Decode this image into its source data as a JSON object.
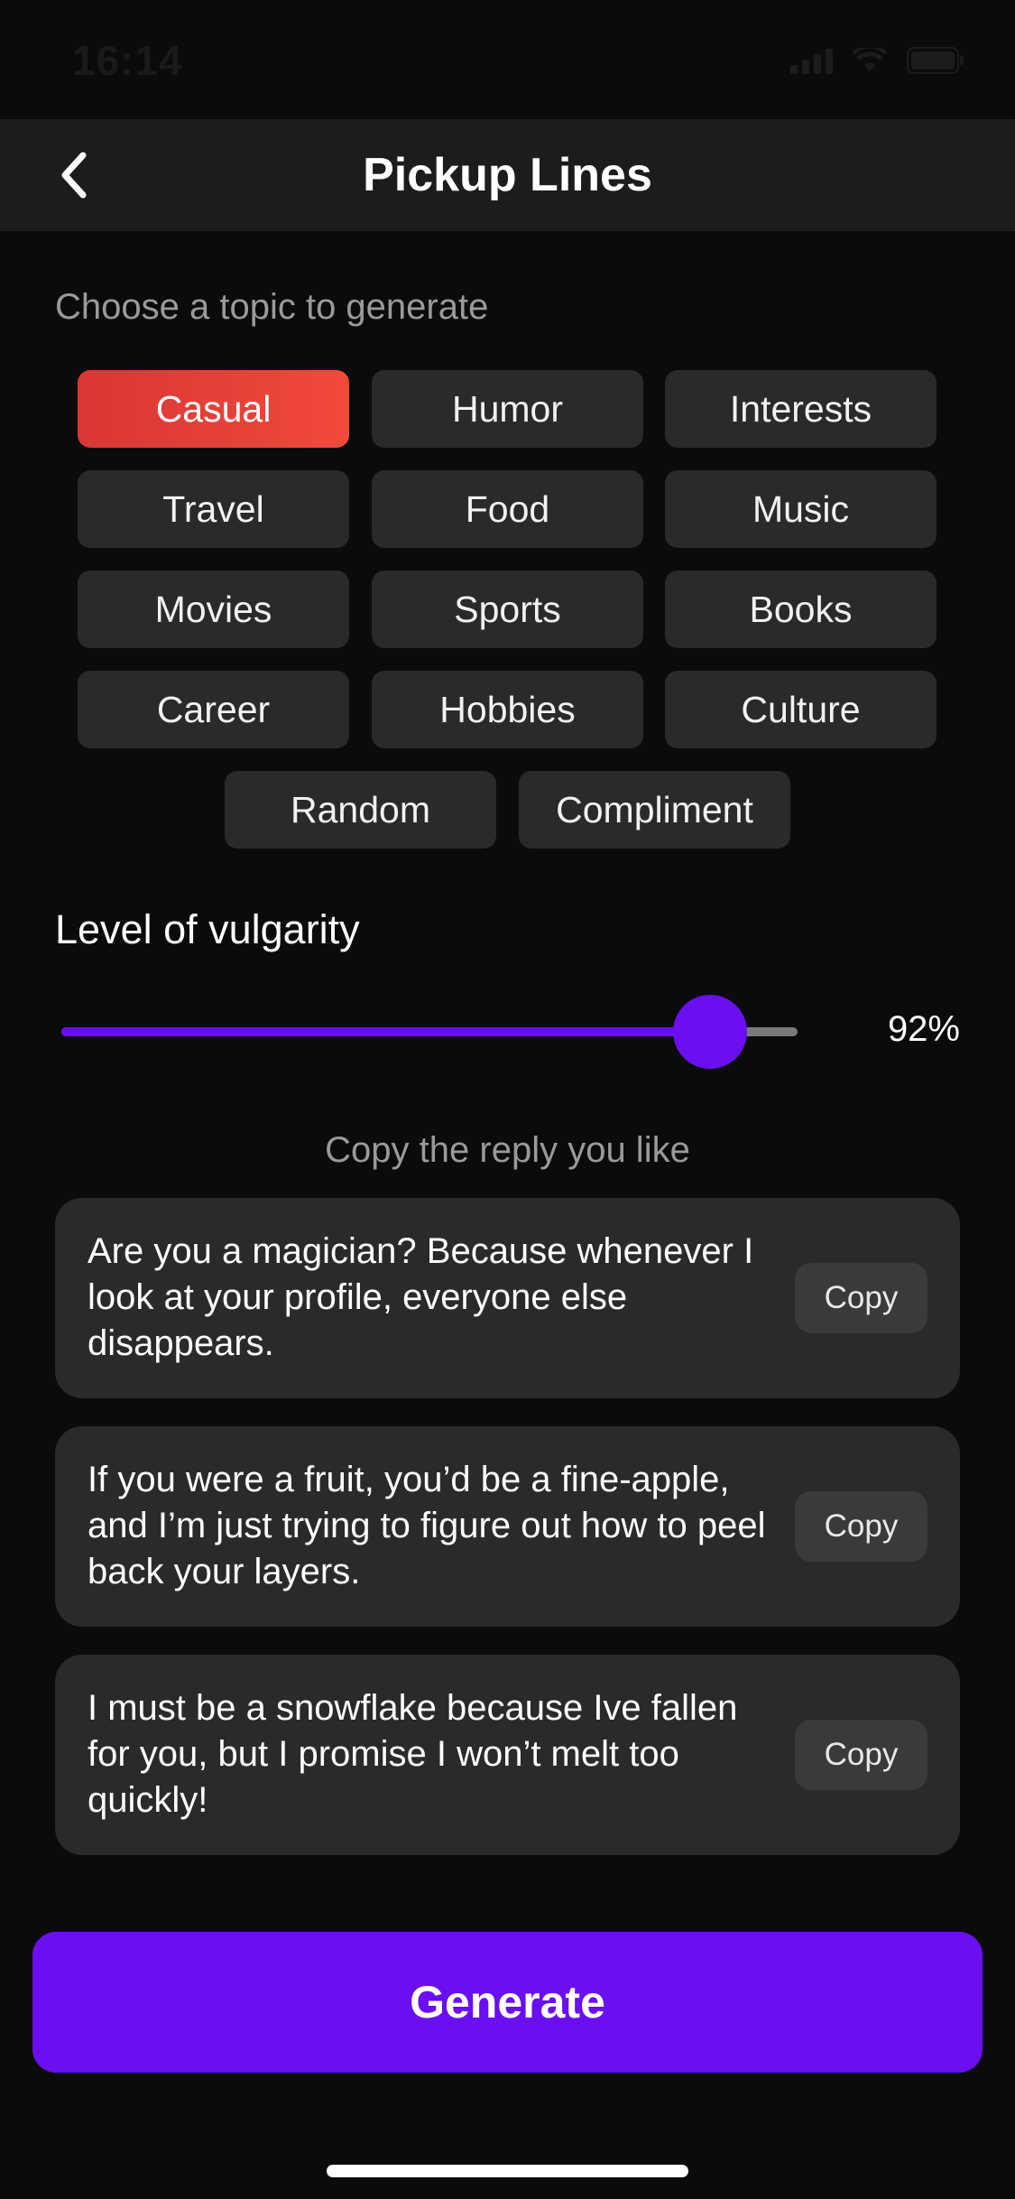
{
  "status_bar": {
    "time": "16:14"
  },
  "header": {
    "title": "Pickup Lines",
    "back_icon": "chevron-left-icon"
  },
  "topics": {
    "prompt": "Choose a topic to generate",
    "selected": "Casual",
    "selected_color": "#e53e36",
    "items": [
      "Casual",
      "Humor",
      "Interests",
      "Travel",
      "Food",
      "Music",
      "Movies",
      "Sports",
      "Books",
      "Career",
      "Hobbies",
      "Culture",
      "Random",
      "Compliment"
    ]
  },
  "vulgarity": {
    "title": "Level of vulgarity",
    "value": 92,
    "value_label": "92%",
    "accent_color": "#6a0ff0"
  },
  "replies": {
    "prompt": "Copy the reply you like",
    "items": [
      {
        "text": "Are you a magician? Because whenever I look at your profile, everyone else disappears.",
        "copy_label": "Copy"
      },
      {
        "text": "If you were a fruit, you’d be a fine-apple, and I’m just trying to figure out how to peel back your layers.",
        "copy_label": "Copy"
      },
      {
        "text": "I must be a snowflake because Ive fallen for you, but I promise I won’t melt too quickly!",
        "copy_label": "Copy"
      }
    ]
  },
  "generate": {
    "label": "Generate",
    "color": "#6a0ff0"
  }
}
